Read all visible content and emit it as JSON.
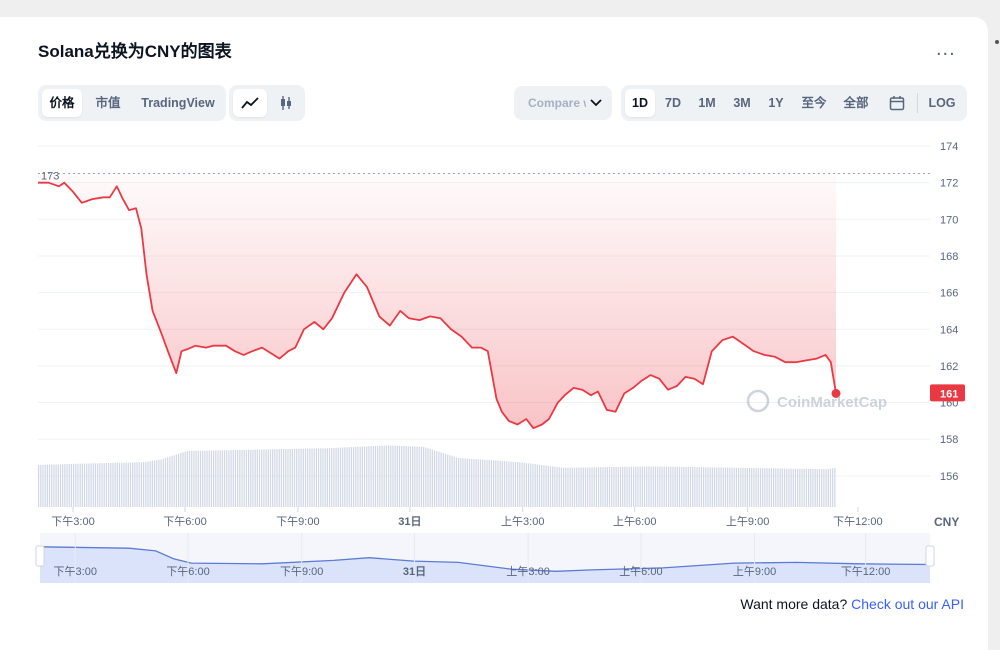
{
  "title": "Solana兑换为CNY的图表",
  "more_label": "...",
  "tabs": [
    "价格",
    "市值",
    "TradingView"
  ],
  "chart_types": [
    "line-chart-icon",
    "candlestick-icon"
  ],
  "compare_label": "Compare with",
  "ranges": [
    "1D",
    "7D",
    "1M",
    "3M",
    "1Y",
    "至今",
    "全部"
  ],
  "calendar_icon": "calendar-icon",
  "log_label": "LOG",
  "currency_label": "CNY",
  "watermark": "CoinMarketCap",
  "api_prompt": "Want more data?",
  "api_link": "Check out our API",
  "colors": {
    "line": "#ea3943",
    "volume": "#cfd6e4",
    "navigator_fill": "#dbe3fb",
    "navigator_line": "#5b7bd5",
    "accent": "#3861fb"
  },
  "chart_data": {
    "type": "line",
    "y_axis_ticks": [
      "174",
      "172",
      "170",
      "168",
      "166",
      "164",
      "162",
      "160",
      "158",
      "156"
    ],
    "ylim": [
      155,
      174.5
    ],
    "xlim": [
      0,
      1
    ],
    "x_tick_labels": [
      "下午3:00",
      "下午6:00",
      "下午9:00",
      "31日",
      "上午3:00",
      "上午6:00",
      "上午9:00",
      "下午12:00"
    ],
    "x_tick_positions": [
      0.04,
      0.168,
      0.297,
      0.425,
      0.554,
      0.682,
      0.811,
      0.937
    ],
    "reference_level": 172.5,
    "reference_label": "173",
    "current_price": 160.5,
    "current_price_label": "161",
    "price_series": [
      [
        0.0,
        172.0
      ],
      [
        0.012,
        172.0
      ],
      [
        0.024,
        171.8
      ],
      [
        0.03,
        172.0
      ],
      [
        0.04,
        171.5
      ],
      [
        0.05,
        170.9
      ],
      [
        0.062,
        171.1
      ],
      [
        0.075,
        171.2
      ],
      [
        0.082,
        171.2
      ],
      [
        0.09,
        171.8
      ],
      [
        0.096,
        171.2
      ],
      [
        0.104,
        170.5
      ],
      [
        0.112,
        170.6
      ],
      [
        0.118,
        169.5
      ],
      [
        0.124,
        167.0
      ],
      [
        0.131,
        165.0
      ],
      [
        0.14,
        163.9
      ],
      [
        0.15,
        162.6
      ],
      [
        0.158,
        161.6
      ],
      [
        0.164,
        162.8
      ],
      [
        0.17,
        162.9
      ],
      [
        0.18,
        163.1
      ],
      [
        0.192,
        163.0
      ],
      [
        0.2,
        163.1
      ],
      [
        0.215,
        163.1
      ],
      [
        0.225,
        162.8
      ],
      [
        0.235,
        162.6
      ],
      [
        0.245,
        162.8
      ],
      [
        0.256,
        163.0
      ],
      [
        0.266,
        162.7
      ],
      [
        0.276,
        162.4
      ],
      [
        0.286,
        162.8
      ],
      [
        0.294,
        163.0
      ],
      [
        0.304,
        164.0
      ],
      [
        0.316,
        164.4
      ],
      [
        0.326,
        164.0
      ],
      [
        0.336,
        164.6
      ],
      [
        0.35,
        166.0
      ],
      [
        0.364,
        167.0
      ],
      [
        0.376,
        166.3
      ],
      [
        0.39,
        164.7
      ],
      [
        0.402,
        164.2
      ],
      [
        0.414,
        165.0
      ],
      [
        0.424,
        164.6
      ],
      [
        0.436,
        164.5
      ],
      [
        0.448,
        164.7
      ],
      [
        0.46,
        164.6
      ],
      [
        0.472,
        164.0
      ],
      [
        0.484,
        163.6
      ],
      [
        0.496,
        163.0
      ],
      [
        0.506,
        163.0
      ],
      [
        0.514,
        162.8
      ],
      [
        0.524,
        160.2
      ],
      [
        0.53,
        159.5
      ],
      [
        0.538,
        159.0
      ],
      [
        0.548,
        158.8
      ],
      [
        0.558,
        159.1
      ],
      [
        0.566,
        158.6
      ],
      [
        0.576,
        158.8
      ],
      [
        0.584,
        159.1
      ],
      [
        0.594,
        160.0
      ],
      [
        0.602,
        160.4
      ],
      [
        0.612,
        160.8
      ],
      [
        0.622,
        160.7
      ],
      [
        0.632,
        160.4
      ],
      [
        0.64,
        160.6
      ],
      [
        0.65,
        159.6
      ],
      [
        0.66,
        159.5
      ],
      [
        0.67,
        160.5
      ],
      [
        0.68,
        160.8
      ],
      [
        0.69,
        161.2
      ],
      [
        0.7,
        161.5
      ],
      [
        0.71,
        161.3
      ],
      [
        0.72,
        160.7
      ],
      [
        0.73,
        160.9
      ],
      [
        0.74,
        161.4
      ],
      [
        0.75,
        161.3
      ],
      [
        0.76,
        161.0
      ],
      [
        0.77,
        162.8
      ],
      [
        0.782,
        163.4
      ],
      [
        0.794,
        163.6
      ],
      [
        0.806,
        163.2
      ],
      [
        0.818,
        162.8
      ],
      [
        0.83,
        162.6
      ],
      [
        0.842,
        162.5
      ],
      [
        0.854,
        162.2
      ],
      [
        0.866,
        162.2
      ],
      [
        0.878,
        162.3
      ],
      [
        0.89,
        162.4
      ],
      [
        0.9,
        162.6
      ],
      [
        0.906,
        162.2
      ],
      [
        0.912,
        160.5
      ]
    ],
    "volume_series": [
      [
        0.0,
        0.6
      ],
      [
        0.05,
        0.62
      ],
      [
        0.12,
        0.64
      ],
      [
        0.14,
        0.68
      ],
      [
        0.17,
        0.8
      ],
      [
        0.25,
        0.82
      ],
      [
        0.33,
        0.84
      ],
      [
        0.4,
        0.88
      ],
      [
        0.44,
        0.86
      ],
      [
        0.48,
        0.7
      ],
      [
        0.55,
        0.64
      ],
      [
        0.6,
        0.56
      ],
      [
        0.7,
        0.58
      ],
      [
        0.8,
        0.56
      ],
      [
        0.9,
        0.54
      ],
      [
        0.912,
        0.56
      ]
    ],
    "navigator_series": [
      [
        0.0,
        0.2
      ],
      [
        0.1,
        0.24
      ],
      [
        0.13,
        0.32
      ],
      [
        0.15,
        0.55
      ],
      [
        0.17,
        0.68
      ],
      [
        0.25,
        0.7
      ],
      [
        0.33,
        0.6
      ],
      [
        0.37,
        0.52
      ],
      [
        0.42,
        0.62
      ],
      [
        0.47,
        0.66
      ],
      [
        0.53,
        0.86
      ],
      [
        0.58,
        0.92
      ],
      [
        0.62,
        0.88
      ],
      [
        0.7,
        0.82
      ],
      [
        0.78,
        0.68
      ],
      [
        0.85,
        0.66
      ],
      [
        0.92,
        0.7
      ],
      [
        1.0,
        0.72
      ]
    ]
  }
}
